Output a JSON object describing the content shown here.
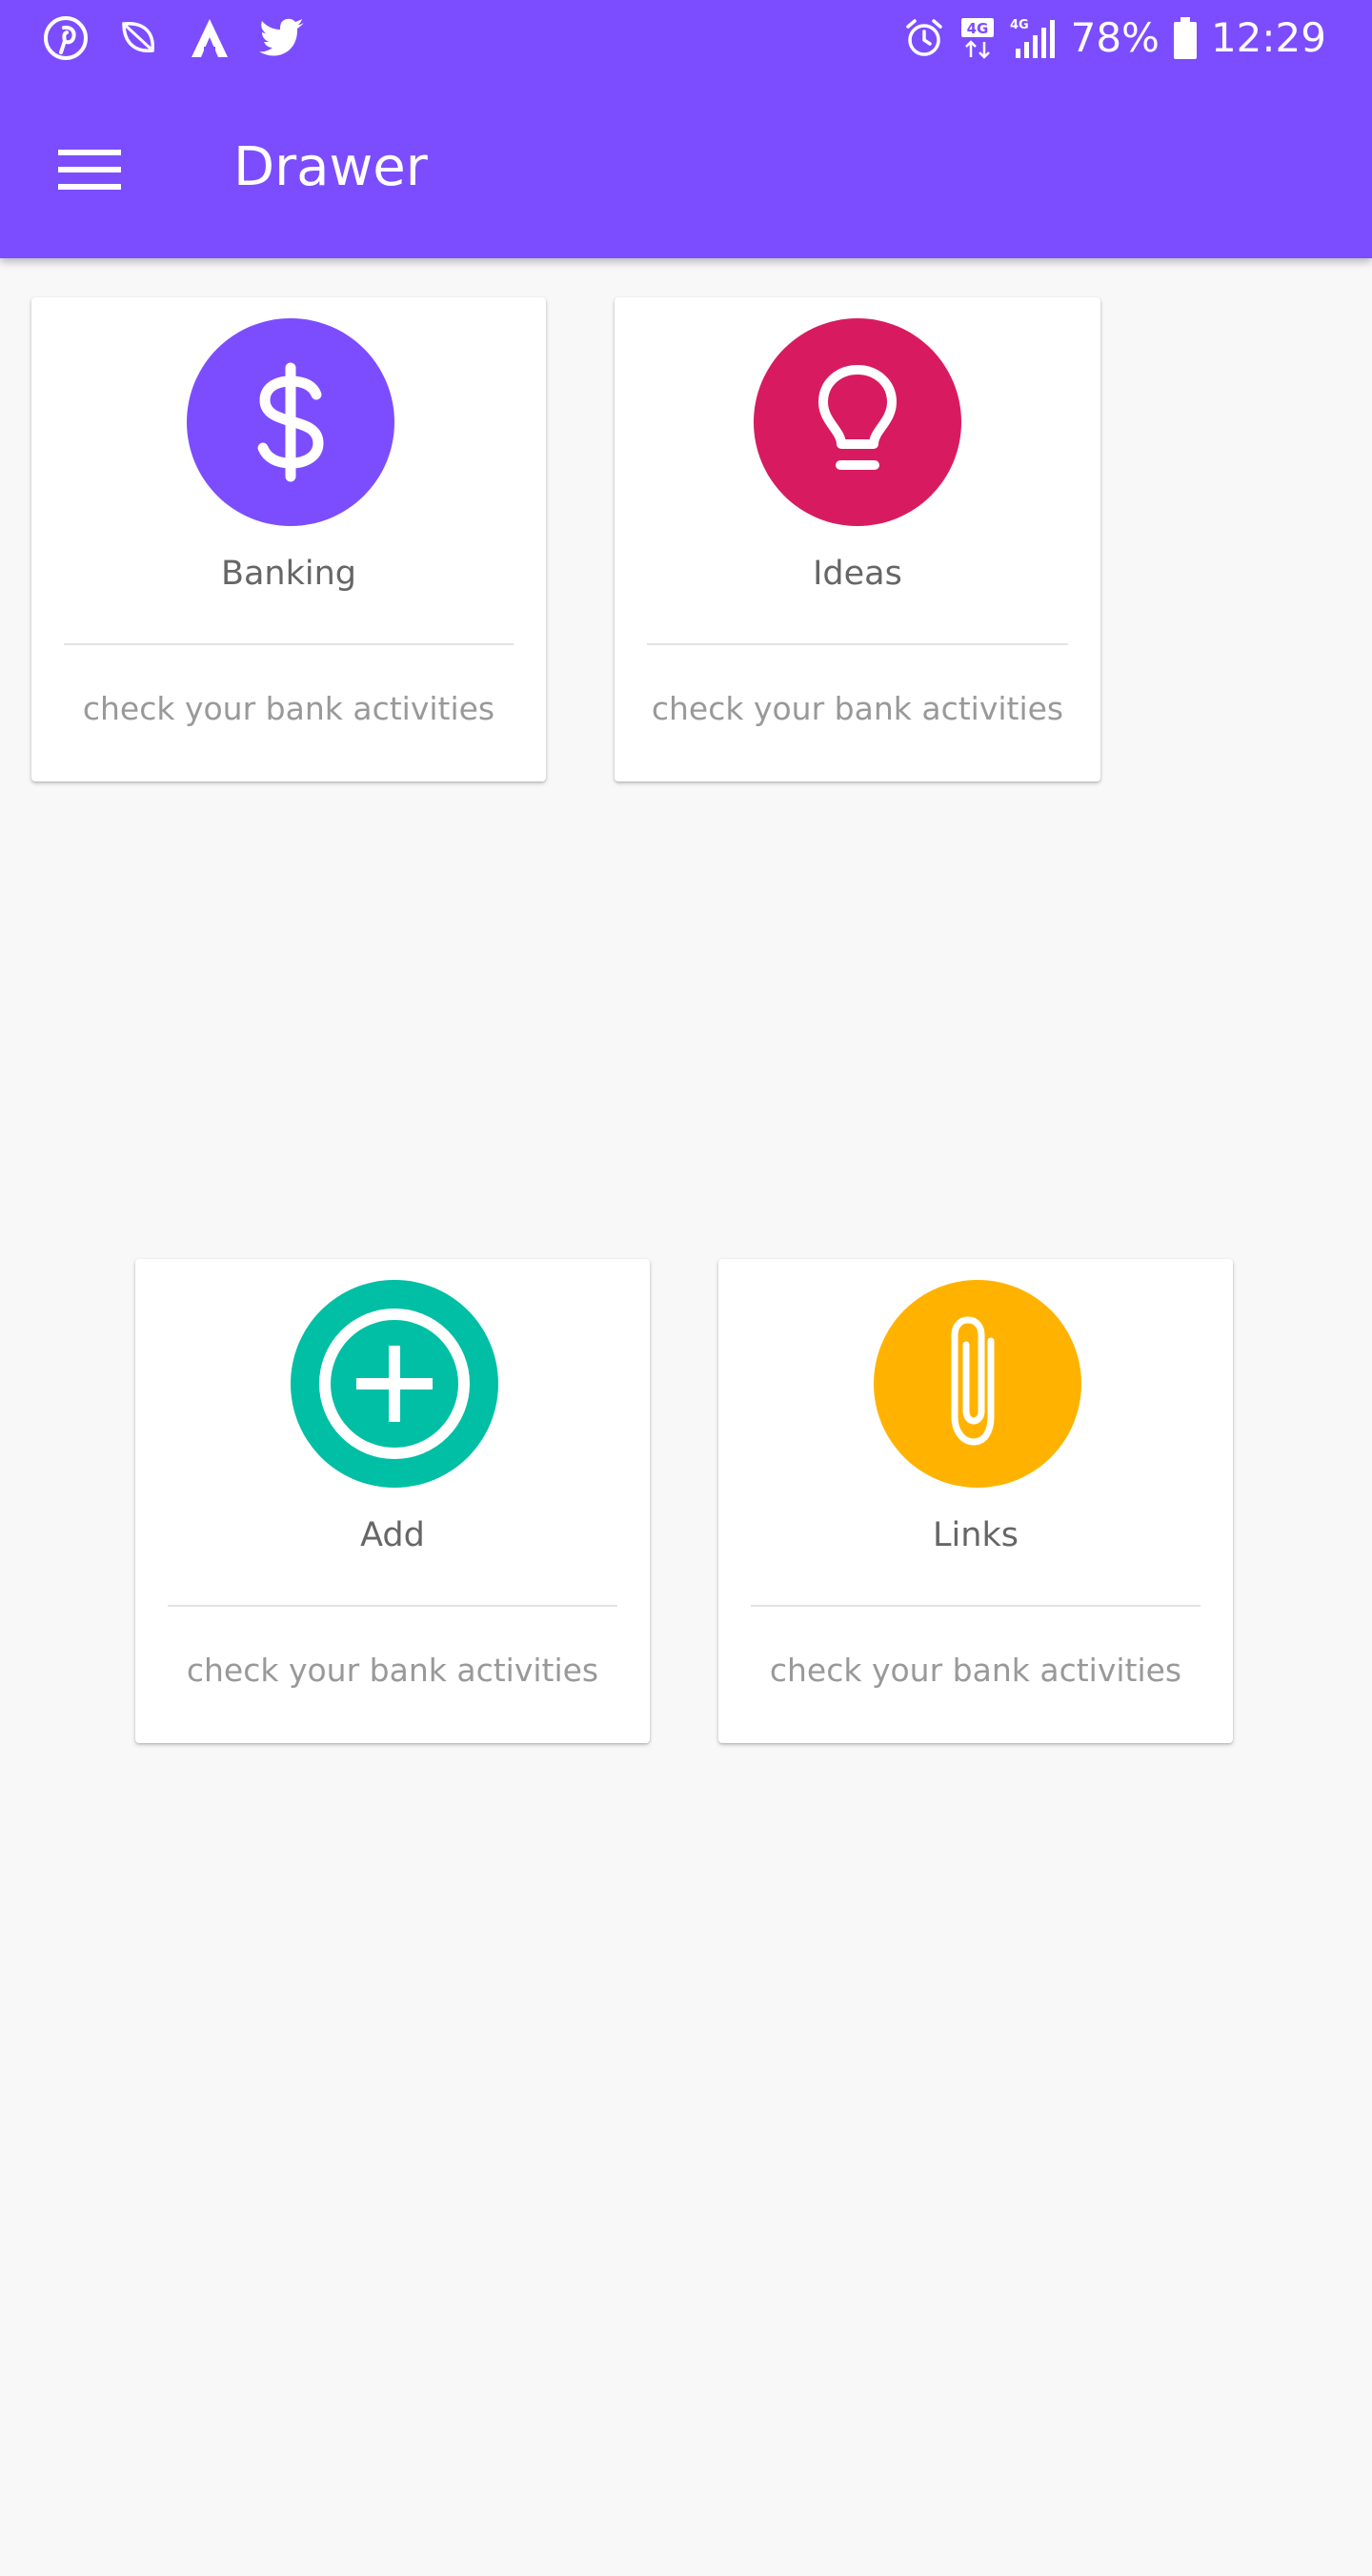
{
  "status_bar": {
    "battery_text": "78%",
    "time": "12:29",
    "network": "4G",
    "left_icons": [
      "pinterest-icon",
      "leaf-notification-icon",
      "arrow-logo-icon",
      "twitter-icon"
    ],
    "right_icons": [
      "alarm-icon",
      "data-transfer-icon",
      "signal-icon",
      "battery-icon"
    ]
  },
  "app_bar": {
    "title": "Drawer",
    "menu_icon": "hamburger-menu-icon",
    "color": "#7c4dff"
  },
  "cards": [
    {
      "title": "Banking",
      "subtitle": "check your bank activities",
      "icon": "dollar-icon",
      "color": "#7c4dff"
    },
    {
      "title": "Ideas",
      "subtitle": "check your bank activities",
      "icon": "lightbulb-icon",
      "color": "#d81b60"
    },
    {
      "title": "Add",
      "subtitle": "check your bank activities",
      "icon": "add-circle-icon",
      "color": "#00bfa5"
    },
    {
      "title": "Links",
      "subtitle": "check your bank activities",
      "icon": "paperclip-icon",
      "color": "#ffb300"
    }
  ]
}
